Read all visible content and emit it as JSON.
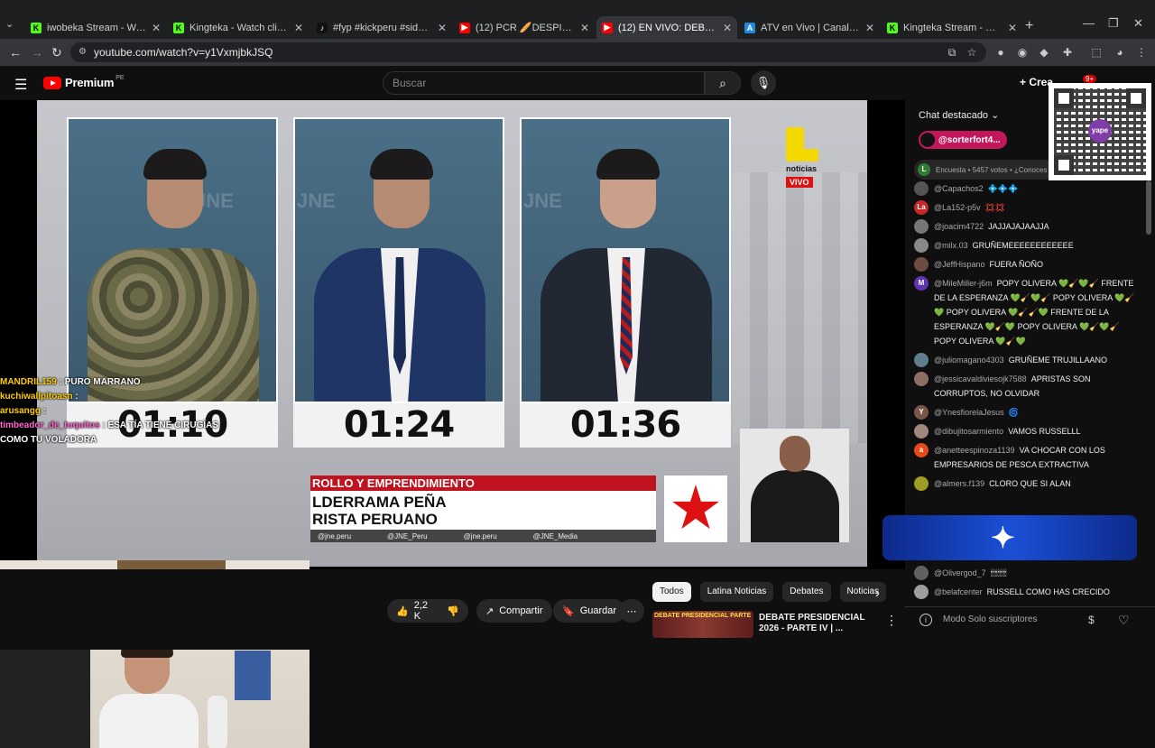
{
  "browser": {
    "tabs": [
      {
        "title": "iwobeka Stream - Watch Live o",
        "fav_color": "#53fc18",
        "fav_glyph": "K"
      },
      {
        "title": "Kingteka - Watch clips on Kick",
        "fav_color": "#53fc18",
        "fav_glyph": "K"
      },
      {
        "title": "#fyp #kickperu #sideral | sidera",
        "fav_color": "#111111",
        "fav_glyph": "♪"
      },
      {
        "title": "(12) PCR 🥖DESPIERTA PERU -",
        "fav_color": "#ff0000",
        "fav_glyph": "▶"
      },
      {
        "title": "(12) EN VIVO: DEBATE PRES",
        "fav_color": "#ff0000",
        "fav_glyph": "▶"
      },
      {
        "title": "ATV en Vivo | Canal 9 - Disfruta",
        "fav_color": "#1e88e5",
        "fav_glyph": "A"
      },
      {
        "title": "Kingteka Stream - Watch Live o",
        "fav_color": "#53fc18",
        "fav_glyph": "K"
      }
    ],
    "active_tab": 4,
    "url": "youtube.com/watch?v=y1VxmjbkJSQ"
  },
  "youtube": {
    "logo_text": "Premium",
    "country": "PE",
    "search_placeholder": "Buscar",
    "create_label": "Crea",
    "notif_count": "9+"
  },
  "video": {
    "timers": [
      "01:10",
      "01:24",
      "01:36"
    ],
    "lower_third": {
      "category": "ROLLO Y EMPRENDIMIENTO",
      "name": "LDERRAMA PEÑA",
      "party": "RISTA PERUANO"
    },
    "socials": [
      "@jne.peru",
      "@JNE_Peru",
      "@jne.peru",
      "@JNE_Media"
    ],
    "logo": {
      "name": "noticias",
      "badge": "VIVO"
    },
    "apra_logo_text": "APRA",
    "watermark": "JNE"
  },
  "kick_chat": [
    {
      "user": "MANDRIL159",
      "msg": "PURO MARRANO",
      "color": "yellow"
    },
    {
      "user": "kuchiwallpitoasn",
      "msg": "",
      "color": "yellow"
    },
    {
      "user": "arusangg",
      "msg": "",
      "color": "yellow"
    },
    {
      "user": "timbeador_de_tuquitos",
      "msg": "ESA TÍA TIENE CIRUGÍAS COMO TU VOLADORA",
      "color": "pink"
    }
  ],
  "actions": {
    "likes": "2,2 K",
    "share": "Compartir",
    "save": "Guardar"
  },
  "chips": [
    "Todos",
    "Latina Noticias",
    "Debates",
    "Noticias"
  ],
  "recommended": {
    "title": "DEBATE PRESIDENCIAL 2026 - PARTE IV | ...",
    "thumb_text": "DEBATE PRESIDENCIAL PARTE"
  },
  "chat": {
    "header": "Chat destacado",
    "pinned_user": "@sorterfort4...",
    "poll": "Encuesta • 5457 votos • ¿Conoces",
    "messages": [
      {
        "author": "@Capachos2",
        "text": "💠💠💠",
        "av_color": "#555555",
        "av_txt": ""
      },
      {
        "author": "@La152-p5v",
        "text": "💢💢",
        "av_color": "#c62828",
        "av_txt": "La"
      },
      {
        "author": "@joacim4722",
        "text": "JAJJAJAJAAJJA",
        "av_color": "#777777",
        "av_txt": ""
      },
      {
        "author": "@milx.03",
        "text": "GRUÑEMEEEEEEEEEEEE",
        "av_color": "#888888",
        "av_txt": ""
      },
      {
        "author": "@JeffHispano",
        "text": "FUERA ÑOÑO",
        "av_color": "#6d4c41",
        "av_txt": ""
      },
      {
        "author": "@MileMiller-j6m",
        "text": "POPY OLIVERA 💚🧹💚🧹 FRENTE DE LA ESPERANZA 💚🧹💚🧹 POPY OLIVERA 💚🧹💚 POPY OLIVERA 💚🧹🧹💚 FRENTE DE LA ESPERANZA 💚🧹💚 POPY OLIVERA 💚🧹💚🧹 POPY OLIVERA 💚🧹💚",
        "av_color": "#5e35b1",
        "av_txt": "M"
      },
      {
        "author": "@juliomagano4303",
        "text": "GRUÑEME TRUJILLAANO",
        "av_color": "#607d8b",
        "av_txt": ""
      },
      {
        "author": "@jessicavaldiviesojk7588",
        "text": "APRISTAS SON CORRUPTOS, NO OLVIDAR",
        "av_color": "#8d6e63",
        "av_txt": ""
      },
      {
        "author": "@YnesfiorelaJesus",
        "text": "🌀",
        "av_color": "#795548",
        "av_txt": "Y"
      },
      {
        "author": "@dibujitosarmiento",
        "text": "VAMOS RUSSELLL",
        "av_color": "#a1887f",
        "av_txt": ""
      },
      {
        "author": "@anetteespinoza1139",
        "text": "VA CHOCAR CON LOS EMPRESARIOS DE PESCA EXTRACTIVA",
        "av_color": "#e64a19",
        "av_txt": "a"
      },
      {
        "author": "@almers.f139",
        "text": "CLORO QUE SI ALAN",
        "av_color": "#9e9d24",
        "av_txt": ""
      }
    ],
    "bottom_messages": [
      {
        "author": "@Olivergod_7",
        "text": "🕯🕯🕯🕯🕯🕯🕯",
        "av_color": "#616161",
        "av_txt": ""
      },
      {
        "author": "@belafcenter",
        "text": "RUSSELL COMO HAS CRECIDO",
        "av_color": "#9e9e9e",
        "av_txt": ""
      }
    ],
    "input_placeholder": "Modo Solo suscriptores"
  }
}
